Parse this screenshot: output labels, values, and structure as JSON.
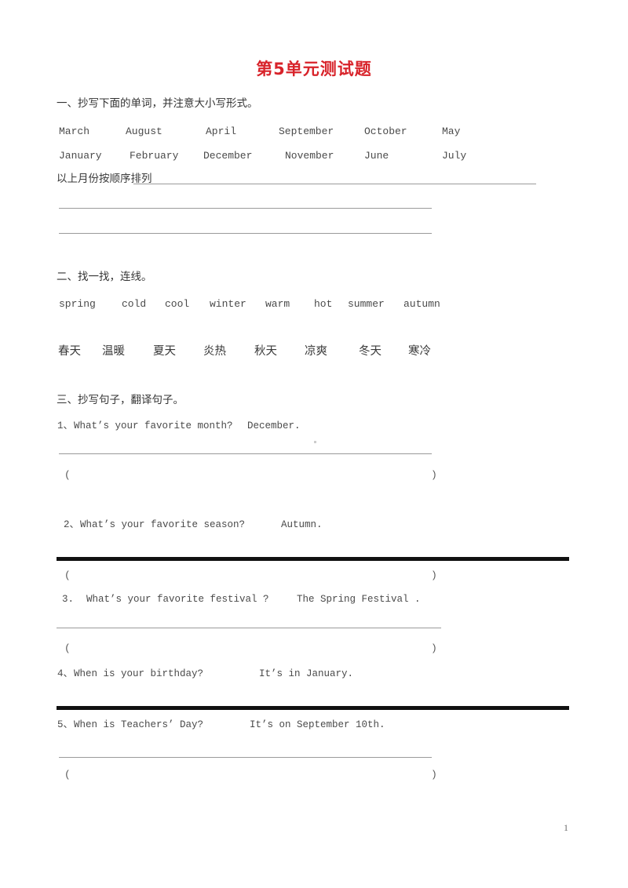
{
  "document": {
    "title": "第5单元测试题",
    "title_color": "#d8232a",
    "page_number": "1"
  },
  "section1": {
    "heading": "一、抄写下面的单词，并注意大小写形式。",
    "months_row1": [
      "March",
      "August",
      "April",
      "September",
      "October",
      "May"
    ],
    "months_row2": [
      "January",
      "February",
      "December",
      "November",
      "June",
      "July"
    ],
    "instruction": "以上月份按顺序排列"
  },
  "section2": {
    "heading": "二、找一找，连线。",
    "english_words": [
      "spring",
      "cold",
      "cool",
      "winter",
      "warm",
      "hot",
      "summer",
      "autumn"
    ],
    "chinese_words": [
      "春天",
      "温暖",
      "夏天",
      "炎热",
      "秋天",
      "凉爽",
      "冬天",
      "寒冷"
    ]
  },
  "section3": {
    "heading": "三、抄写句子，翻译句子。",
    "questions": [
      {
        "number": "1、",
        "question": "What’s your favorite month?",
        "answer": "December.",
        "paren_open": "(",
        "paren_close": ")"
      },
      {
        "number": "2、",
        "question": "What’s your favorite season?",
        "answer": "Autumn.",
        "paren_open": "(",
        "paren_close": ")"
      },
      {
        "number": "3.",
        "question": "What’s your favorite festival ?",
        "answer": "The Spring Festival .",
        "paren_open": "(",
        "paren_close": ")"
      },
      {
        "number": "4、",
        "question": "When is your birthday?",
        "answer": "It’s in January.",
        "paren_open": "(",
        "paren_close": ")"
      },
      {
        "number": "5、",
        "question": "When is Teachers’ Day?",
        "answer": "It’s on September 10th.",
        "paren_open": "(",
        "paren_close": ")"
      }
    ]
  }
}
